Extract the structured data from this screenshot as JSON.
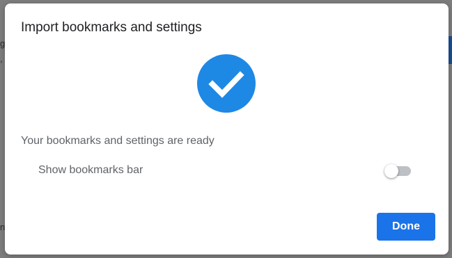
{
  "dialog": {
    "title": "Import bookmarks and settings",
    "status_icon": "check-circle-icon",
    "message": "Your bookmarks and settings are ready",
    "toggle": {
      "label": "Show bookmarks bar",
      "checked": false
    },
    "done_label": "Done"
  },
  "colors": {
    "accent": "#1a73e8",
    "check_circle": "#1e88e5",
    "overlay": "#7d7d7d",
    "text_primary": "#202124",
    "text_secondary": "#5f6368"
  }
}
